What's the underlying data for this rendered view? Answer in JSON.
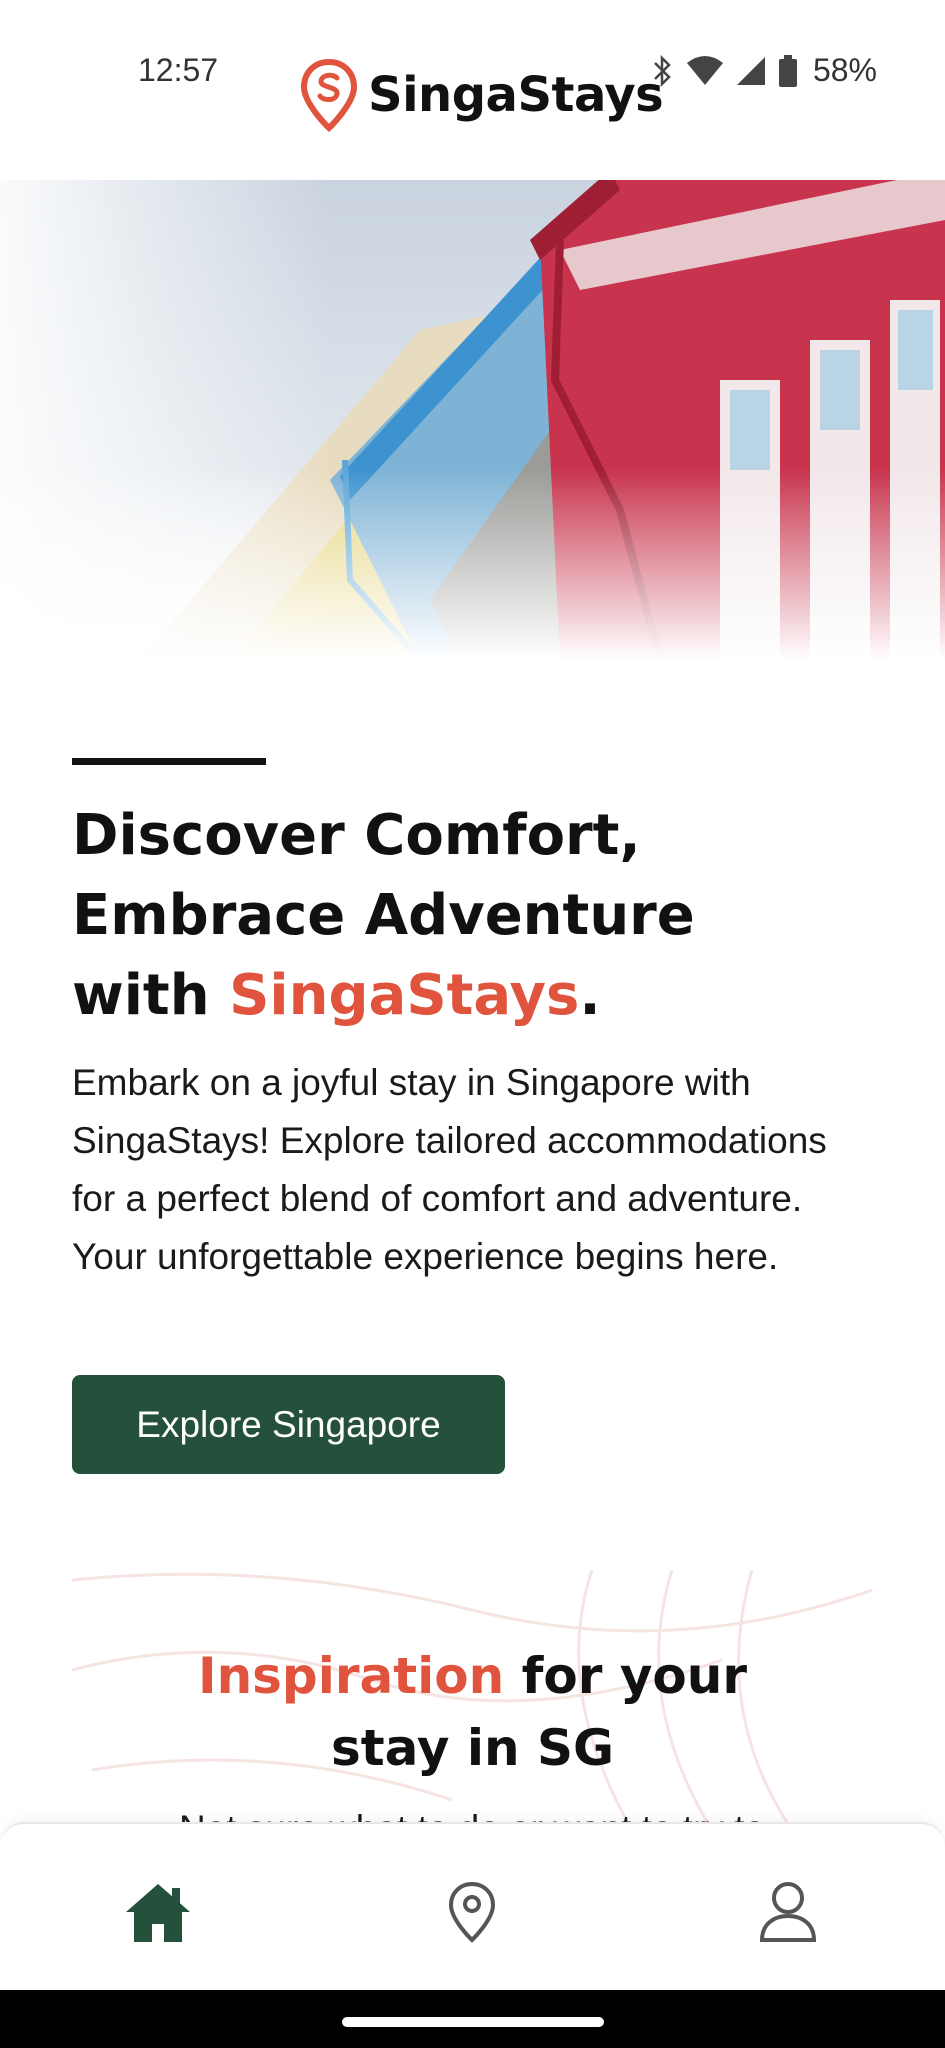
{
  "status_bar": {
    "time": "12:57",
    "battery_percent": "58%",
    "icons": [
      "bluetooth-icon",
      "wifi-icon",
      "signal-icon",
      "battery-icon"
    ]
  },
  "header": {
    "brand_name": "SingaStays",
    "logo_icon": "location-pin-logo-icon"
  },
  "hero": {
    "image_semantic": "colorful-singapore-shophouses"
  },
  "intro": {
    "headline_line1": "Discover Comfort,",
    "headline_line2": "Embrace Adventure",
    "headline_line3_prefix": "with ",
    "headline_brand": "SingaStays",
    "headline_suffix": ".",
    "paragraph": "Embark on a joyful stay in Singapore with SingaStays! Explore tailored accommodations for a perfect blend of comfort and adventure. Your unforgettable experience begins here.",
    "cta_label": "Explore Singapore"
  },
  "inspiration": {
    "title_accent": "Inspiration",
    "title_rest_line1": " for your",
    "title_line2": "stay in SG",
    "subtitle_partial": "Not sure what to do or want to try to"
  },
  "bottom_nav": {
    "items": [
      {
        "icon": "home-icon",
        "active": true
      },
      {
        "icon": "map-pin-icon",
        "active": false
      },
      {
        "icon": "profile-icon",
        "active": false
      }
    ]
  },
  "colors": {
    "accent": "#e0533d",
    "primary_button": "#24503c",
    "active_nav": "#24503c",
    "inactive_nav": "#555555"
  }
}
